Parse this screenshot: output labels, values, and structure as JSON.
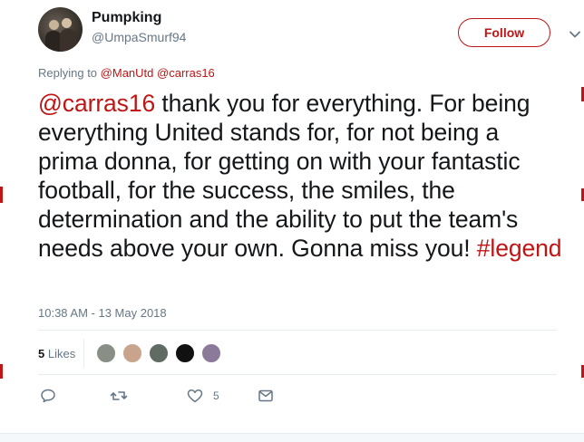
{
  "colors": {
    "accent": "#c01515",
    "secondary_text": "#657786",
    "primary_text": "#14171a",
    "divider": "#e6ecf0"
  },
  "user": {
    "display_name": "Pumpking",
    "handle": "@UmpaSmurf94"
  },
  "follow": {
    "label": "Follow"
  },
  "menu": {
    "icon": "chevron-down-icon"
  },
  "reply": {
    "prefix": "Replying to",
    "mention_1": "@ManUtd",
    "mention_2": "@carras16"
  },
  "tweet": {
    "mention": "@carras16",
    "text": " thank you for everything. For being everything United stands for, for not being a prima donna, for getting on with your fantastic football, for the success, the smiles, the determination and the ability to put the team's needs above your own. Gonna miss you! ",
    "hashtag": "#legend"
  },
  "timestamp": "10:38 AM - 13 May 2018",
  "likes": {
    "count": "5",
    "label": "Likes",
    "avatars": [
      {
        "name": "liker-avatar-1",
        "color": "#8a8f86"
      },
      {
        "name": "liker-avatar-2",
        "color": "#c9a48c"
      },
      {
        "name": "liker-avatar-3",
        "color": "#5f6b63"
      },
      {
        "name": "liker-avatar-4",
        "color": "#111111"
      },
      {
        "name": "liker-avatar-5",
        "color": "#8c7a9a"
      }
    ]
  },
  "actions": {
    "reply_icon": "reply-icon",
    "retweet_icon": "retweet-icon",
    "like_icon": "heart-icon",
    "like_count": "5",
    "dm_icon": "envelope-icon"
  }
}
